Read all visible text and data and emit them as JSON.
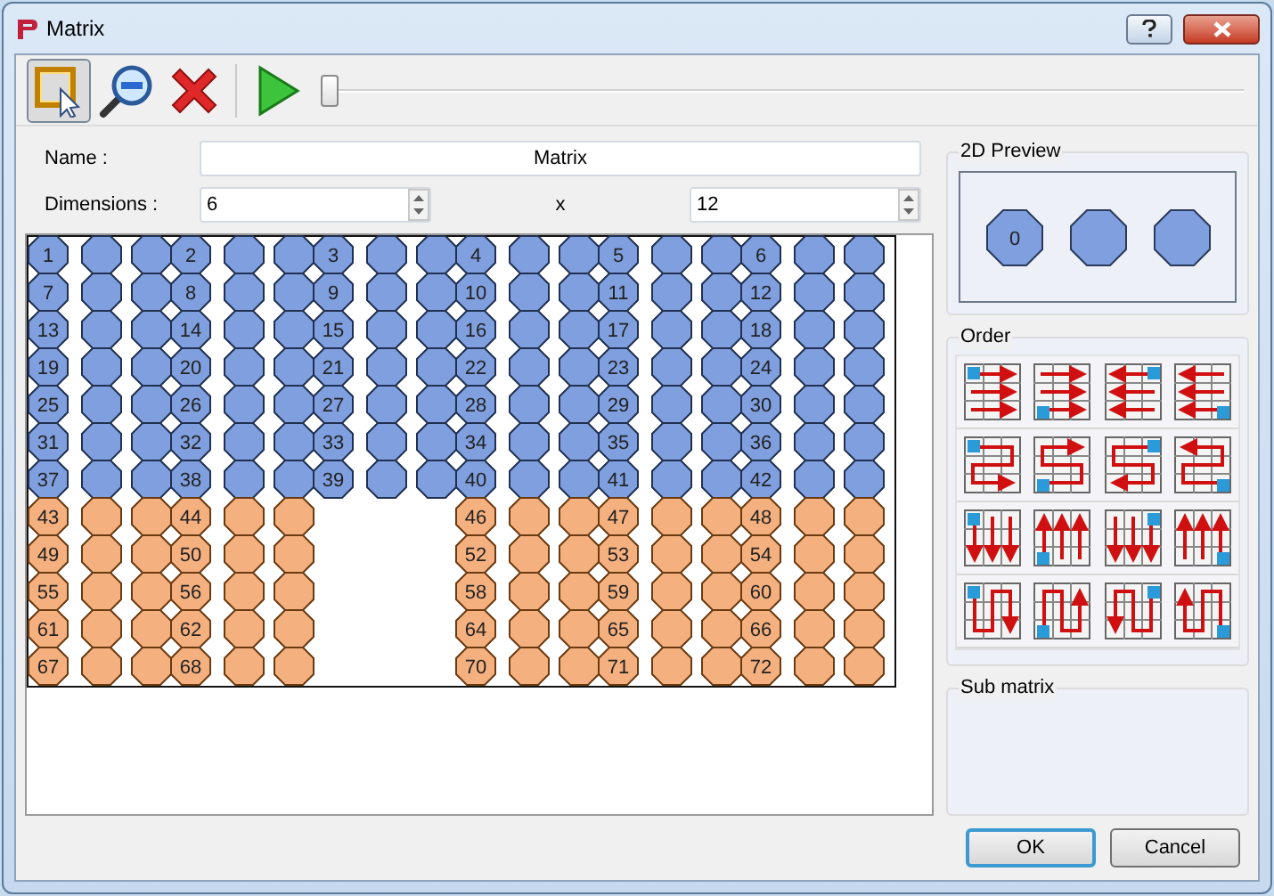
{
  "window": {
    "title": "Matrix"
  },
  "toolbar": [
    {
      "kind": "select",
      "selected": true
    },
    {
      "kind": "zoom",
      "selected": false
    },
    {
      "kind": "delete",
      "selected": false
    },
    {
      "kind": "play",
      "selected": false
    }
  ],
  "slider": {
    "level": 0
  },
  "name": {
    "label": "Name :",
    "value": "Matrix"
  },
  "dimensions": {
    "label": "Dimensions :",
    "rows": "6",
    "separator": "x",
    "columns": "12"
  },
  "matrix": {
    "rows": [
      {
        "color": "#7f9fdf",
        "groups": [
          {
            "kind": "filled",
            "label": "1"
          },
          {
            "kind": "filled",
            "label": "2"
          },
          {
            "kind": "filled",
            "label": "3"
          },
          {
            "kind": "filled",
            "label": "4"
          },
          {
            "kind": "filled",
            "label": "5"
          },
          {
            "kind": "filled",
            "label": "6"
          }
        ]
      },
      {
        "color": "#7f9fdf",
        "groups": [
          {
            "kind": "filled",
            "label": "7"
          },
          {
            "kind": "filled",
            "label": "8"
          },
          {
            "kind": "filled",
            "label": "9"
          },
          {
            "kind": "filled",
            "label": "10"
          },
          {
            "kind": "filled",
            "label": "11"
          },
          {
            "kind": "filled",
            "label": "12"
          }
        ]
      },
      {
        "color": "#7f9fdf",
        "groups": [
          {
            "kind": "filled",
            "label": "13"
          },
          {
            "kind": "filled",
            "label": "14"
          },
          {
            "kind": "filled",
            "label": "15"
          },
          {
            "kind": "filled",
            "label": "16"
          },
          {
            "kind": "filled",
            "label": "17"
          },
          {
            "kind": "filled",
            "label": "18"
          }
        ]
      },
      {
        "color": "#7f9fdf",
        "groups": [
          {
            "kind": "filled",
            "label": "19"
          },
          {
            "kind": "filled",
            "label": "20"
          },
          {
            "kind": "filled",
            "label": "21"
          },
          {
            "kind": "filled",
            "label": "22"
          },
          {
            "kind": "filled",
            "label": "23"
          },
          {
            "kind": "filled",
            "label": "24"
          }
        ]
      },
      {
        "color": "#7f9fdf",
        "groups": [
          {
            "kind": "filled",
            "label": "25"
          },
          {
            "kind": "filled",
            "label": "26"
          },
          {
            "kind": "filled",
            "label": "27"
          },
          {
            "kind": "filled",
            "label": "28"
          },
          {
            "kind": "filled",
            "label": "29"
          },
          {
            "kind": "filled",
            "label": "30"
          }
        ]
      },
      {
        "color": "#7f9fdf",
        "groups": [
          {
            "kind": "filled",
            "label": "31"
          },
          {
            "kind": "filled",
            "label": "32"
          },
          {
            "kind": "filled",
            "label": "33"
          },
          {
            "kind": "filled",
            "label": "34"
          },
          {
            "kind": "filled",
            "label": "35"
          },
          {
            "kind": "filled",
            "label": "36"
          }
        ]
      },
      {
        "color": "#7f9fdf",
        "groups": [
          {
            "kind": "filled",
            "label": "37"
          },
          {
            "kind": "filled",
            "label": "38"
          },
          {
            "kind": "filled",
            "label": "39"
          },
          {
            "kind": "filled",
            "label": "40"
          },
          {
            "kind": "filled",
            "label": "41"
          },
          {
            "kind": "filled",
            "label": "42"
          }
        ]
      },
      {
        "color": "#f5b07f",
        "groups": [
          {
            "kind": "filled",
            "label": "43"
          },
          {
            "kind": "filled",
            "label": "44"
          },
          {
            "kind": "gap"
          },
          {
            "kind": "filled",
            "label": "46"
          },
          {
            "kind": "filled",
            "label": "47"
          },
          {
            "kind": "filled",
            "label": "48"
          }
        ]
      },
      {
        "color": "#f5b07f",
        "groups": [
          {
            "kind": "filled",
            "label": "49"
          },
          {
            "kind": "filled",
            "label": "50"
          },
          {
            "kind": "gap"
          },
          {
            "kind": "filled",
            "label": "52"
          },
          {
            "kind": "filled",
            "label": "53"
          },
          {
            "kind": "filled",
            "label": "54"
          }
        ]
      },
      {
        "color": "#f5b07f",
        "groups": [
          {
            "kind": "filled",
            "label": "55"
          },
          {
            "kind": "filled",
            "label": "56"
          },
          {
            "kind": "gap"
          },
          {
            "kind": "filled",
            "label": "58"
          },
          {
            "kind": "filled",
            "label": "59"
          },
          {
            "kind": "filled",
            "label": "60"
          }
        ]
      },
      {
        "color": "#f5b07f",
        "groups": [
          {
            "kind": "filled",
            "label": "61"
          },
          {
            "kind": "filled",
            "label": "62"
          },
          {
            "kind": "gap"
          },
          {
            "kind": "filled",
            "label": "64"
          },
          {
            "kind": "filled",
            "label": "65"
          },
          {
            "kind": "filled",
            "label": "66"
          }
        ]
      },
      {
        "color": "#f5b07f",
        "groups": [
          {
            "kind": "filled",
            "label": "67"
          },
          {
            "kind": "filled",
            "label": "68"
          },
          {
            "kind": "gap"
          },
          {
            "kind": "filled",
            "label": "70"
          },
          {
            "kind": "filled",
            "label": "71"
          },
          {
            "kind": "filled",
            "label": "72"
          }
        ]
      }
    ]
  },
  "preview": {
    "title": "2D Preview",
    "cells": [
      {
        "kind": "labeled",
        "label": "0"
      },
      {
        "kind": "blank"
      },
      {
        "kind": "blank"
      }
    ]
  },
  "order": {
    "title": "Order"
  },
  "sub_matrix": {
    "title": "Sub matrix"
  },
  "buttons": [
    {
      "label": "OK",
      "kind": "default"
    },
    {
      "label": "Cancel",
      "kind": "normal"
    }
  ]
}
